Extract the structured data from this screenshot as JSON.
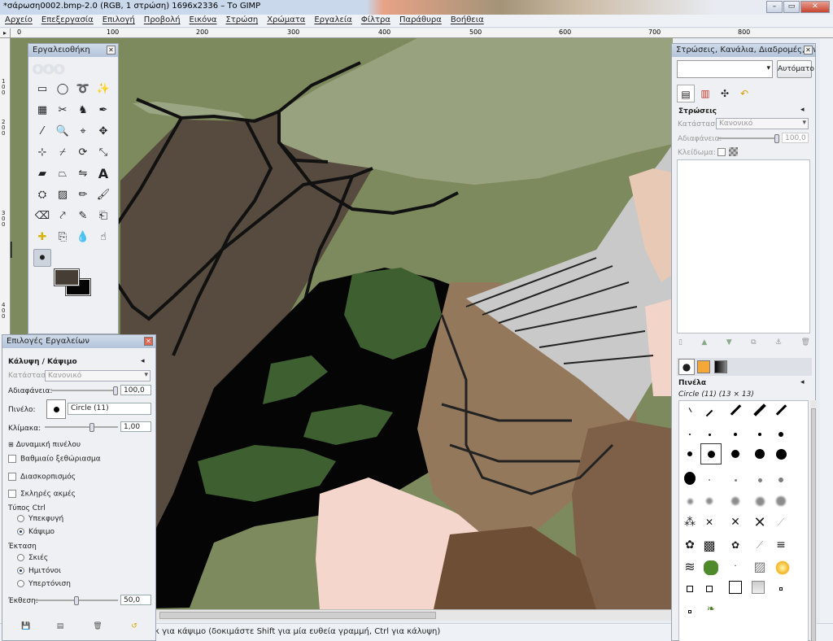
{
  "window": {
    "title": "*σάρωση0002.bmp-2.0 (RGB, 1 στρώση) 1696x2336 – Το GIMP",
    "controls": [
      "minimize",
      "maximize",
      "close"
    ]
  },
  "menu": [
    "Αρχείο",
    "Επεξεργασία",
    "Επιλογή",
    "Προβολή",
    "Εικόνα",
    "Στρώση",
    "Χρώματα",
    "Εργαλεία",
    "Φίλτρα",
    "Παράθυρα",
    "Βοήθεια"
  ],
  "ruler": {
    "h_labels": [
      "0",
      "100",
      "200",
      "300",
      "400",
      "500",
      "600",
      "700",
      "800"
    ],
    "v_labels": [
      "1 0 0",
      "2 0 0",
      "3 0 0",
      "4 0 0"
    ]
  },
  "toolbox": {
    "title": "Εργαλειοθήκη",
    "tools": [
      "rect-select",
      "ellipse-select",
      "free-select",
      "fuzzy-select",
      "color-select",
      "scissors-select",
      "foreground-select",
      "paths",
      "color-picker",
      "zoom",
      "measure",
      "move",
      "align",
      "crop",
      "rotate",
      "scale",
      "shear",
      "perspective",
      "flip",
      "text",
      "cage",
      "blend",
      "pencil",
      "paintbrush",
      "eraser",
      "airbrush",
      "ink",
      "clone",
      "heal",
      "perspective-clone",
      "blur",
      "smudge",
      "dodge-burn"
    ],
    "selected_tool": "dodge-burn",
    "fg_color": "#463d35",
    "bg_color": "#050505"
  },
  "tool_options": {
    "title": "Επιλογές Εργαλείων",
    "heading": "Κάλυψη / Κάψιμο",
    "mode_label": "Κατάσταση:",
    "mode_value": "Κανονικό",
    "opacity_label": "Αδιαφάνεια:",
    "opacity_value": "100,0",
    "brush_label": "Πινέλο:",
    "brush_value": "Circle (11)",
    "scale_label": "Κλίμακα:",
    "scale_value": "1,00",
    "dynamics_label": "Δυναμική πινέλου",
    "fade_label": "Βαθμιαίο ξεθώριασμα",
    "jitter_label": "Διασκορπισμός",
    "hard_label": "Σκληρές ακμές",
    "type_label": "Τύπος Ctrl",
    "type_options": [
      "Υπεκφυγή",
      "Κάψιμο"
    ],
    "type_selected": "Κάψιμο",
    "range_label": "Έκταση",
    "range_options": [
      "Σκιές",
      "Ημιτόνοι",
      "Υπερτόνιση"
    ],
    "range_selected": "Ημιτόνοι",
    "exposure_label": "Έκθεση:",
    "exposure_value": "50,0"
  },
  "layers_dock": {
    "title": "Στρώσεις, Κανάλια, Διαδρομές, Αν...",
    "auto_button": "Αυτόματο",
    "layers_label": "Στρώσεις",
    "mode_label": "Κατάσταση:",
    "mode_value": "Κανονικό",
    "opacity_label": "Αδιαφάνεια:",
    "opacity_value": "100,0",
    "lock_label": "Κλείδωμα:",
    "brushes_label": "Πινέλα",
    "brush_info": "Circle (11) (13 × 13)"
  },
  "status": {
    "message": "κ για κάψιμο (δοκιμάστε Shift για μία ευθεία γραμμή, Ctrl για κάλυψη)"
  }
}
